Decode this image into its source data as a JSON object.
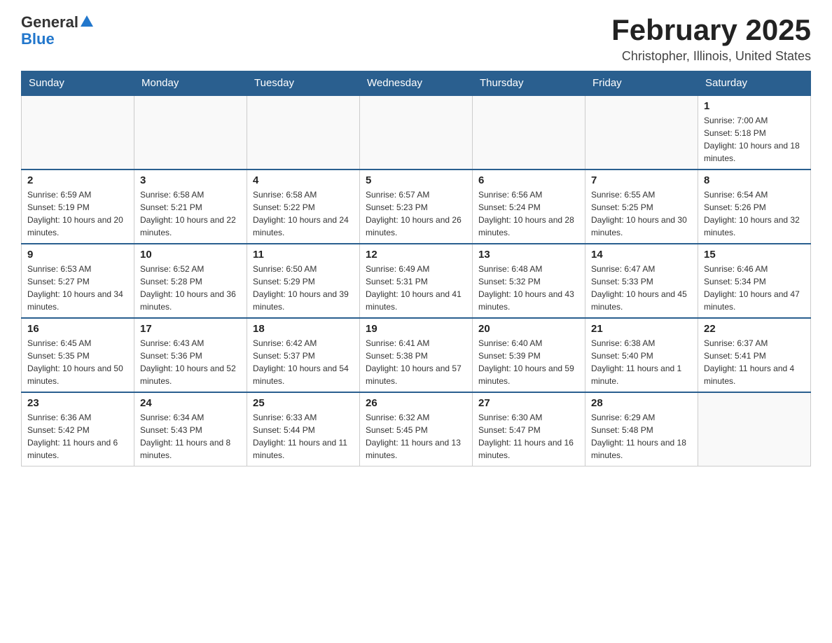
{
  "header": {
    "logo": {
      "general": "General",
      "arrow": "▲",
      "blue": "Blue"
    },
    "month_title": "February 2025",
    "location": "Christopher, Illinois, United States"
  },
  "weekdays": [
    "Sunday",
    "Monday",
    "Tuesday",
    "Wednesday",
    "Thursday",
    "Friday",
    "Saturday"
  ],
  "weeks": [
    [
      {
        "day": "",
        "info": ""
      },
      {
        "day": "",
        "info": ""
      },
      {
        "day": "",
        "info": ""
      },
      {
        "day": "",
        "info": ""
      },
      {
        "day": "",
        "info": ""
      },
      {
        "day": "",
        "info": ""
      },
      {
        "day": "1",
        "info": "Sunrise: 7:00 AM\nSunset: 5:18 PM\nDaylight: 10 hours and 18 minutes."
      }
    ],
    [
      {
        "day": "2",
        "info": "Sunrise: 6:59 AM\nSunset: 5:19 PM\nDaylight: 10 hours and 20 minutes."
      },
      {
        "day": "3",
        "info": "Sunrise: 6:58 AM\nSunset: 5:21 PM\nDaylight: 10 hours and 22 minutes."
      },
      {
        "day": "4",
        "info": "Sunrise: 6:58 AM\nSunset: 5:22 PM\nDaylight: 10 hours and 24 minutes."
      },
      {
        "day": "5",
        "info": "Sunrise: 6:57 AM\nSunset: 5:23 PM\nDaylight: 10 hours and 26 minutes."
      },
      {
        "day": "6",
        "info": "Sunrise: 6:56 AM\nSunset: 5:24 PM\nDaylight: 10 hours and 28 minutes."
      },
      {
        "day": "7",
        "info": "Sunrise: 6:55 AM\nSunset: 5:25 PM\nDaylight: 10 hours and 30 minutes."
      },
      {
        "day": "8",
        "info": "Sunrise: 6:54 AM\nSunset: 5:26 PM\nDaylight: 10 hours and 32 minutes."
      }
    ],
    [
      {
        "day": "9",
        "info": "Sunrise: 6:53 AM\nSunset: 5:27 PM\nDaylight: 10 hours and 34 minutes."
      },
      {
        "day": "10",
        "info": "Sunrise: 6:52 AM\nSunset: 5:28 PM\nDaylight: 10 hours and 36 minutes."
      },
      {
        "day": "11",
        "info": "Sunrise: 6:50 AM\nSunset: 5:29 PM\nDaylight: 10 hours and 39 minutes."
      },
      {
        "day": "12",
        "info": "Sunrise: 6:49 AM\nSunset: 5:31 PM\nDaylight: 10 hours and 41 minutes."
      },
      {
        "day": "13",
        "info": "Sunrise: 6:48 AM\nSunset: 5:32 PM\nDaylight: 10 hours and 43 minutes."
      },
      {
        "day": "14",
        "info": "Sunrise: 6:47 AM\nSunset: 5:33 PM\nDaylight: 10 hours and 45 minutes."
      },
      {
        "day": "15",
        "info": "Sunrise: 6:46 AM\nSunset: 5:34 PM\nDaylight: 10 hours and 47 minutes."
      }
    ],
    [
      {
        "day": "16",
        "info": "Sunrise: 6:45 AM\nSunset: 5:35 PM\nDaylight: 10 hours and 50 minutes."
      },
      {
        "day": "17",
        "info": "Sunrise: 6:43 AM\nSunset: 5:36 PM\nDaylight: 10 hours and 52 minutes."
      },
      {
        "day": "18",
        "info": "Sunrise: 6:42 AM\nSunset: 5:37 PM\nDaylight: 10 hours and 54 minutes."
      },
      {
        "day": "19",
        "info": "Sunrise: 6:41 AM\nSunset: 5:38 PM\nDaylight: 10 hours and 57 minutes."
      },
      {
        "day": "20",
        "info": "Sunrise: 6:40 AM\nSunset: 5:39 PM\nDaylight: 10 hours and 59 minutes."
      },
      {
        "day": "21",
        "info": "Sunrise: 6:38 AM\nSunset: 5:40 PM\nDaylight: 11 hours and 1 minute."
      },
      {
        "day": "22",
        "info": "Sunrise: 6:37 AM\nSunset: 5:41 PM\nDaylight: 11 hours and 4 minutes."
      }
    ],
    [
      {
        "day": "23",
        "info": "Sunrise: 6:36 AM\nSunset: 5:42 PM\nDaylight: 11 hours and 6 minutes."
      },
      {
        "day": "24",
        "info": "Sunrise: 6:34 AM\nSunset: 5:43 PM\nDaylight: 11 hours and 8 minutes."
      },
      {
        "day": "25",
        "info": "Sunrise: 6:33 AM\nSunset: 5:44 PM\nDaylight: 11 hours and 11 minutes."
      },
      {
        "day": "26",
        "info": "Sunrise: 6:32 AM\nSunset: 5:45 PM\nDaylight: 11 hours and 13 minutes."
      },
      {
        "day": "27",
        "info": "Sunrise: 6:30 AM\nSunset: 5:47 PM\nDaylight: 11 hours and 16 minutes."
      },
      {
        "day": "28",
        "info": "Sunrise: 6:29 AM\nSunset: 5:48 PM\nDaylight: 11 hours and 18 minutes."
      },
      {
        "day": "",
        "info": ""
      }
    ]
  ]
}
